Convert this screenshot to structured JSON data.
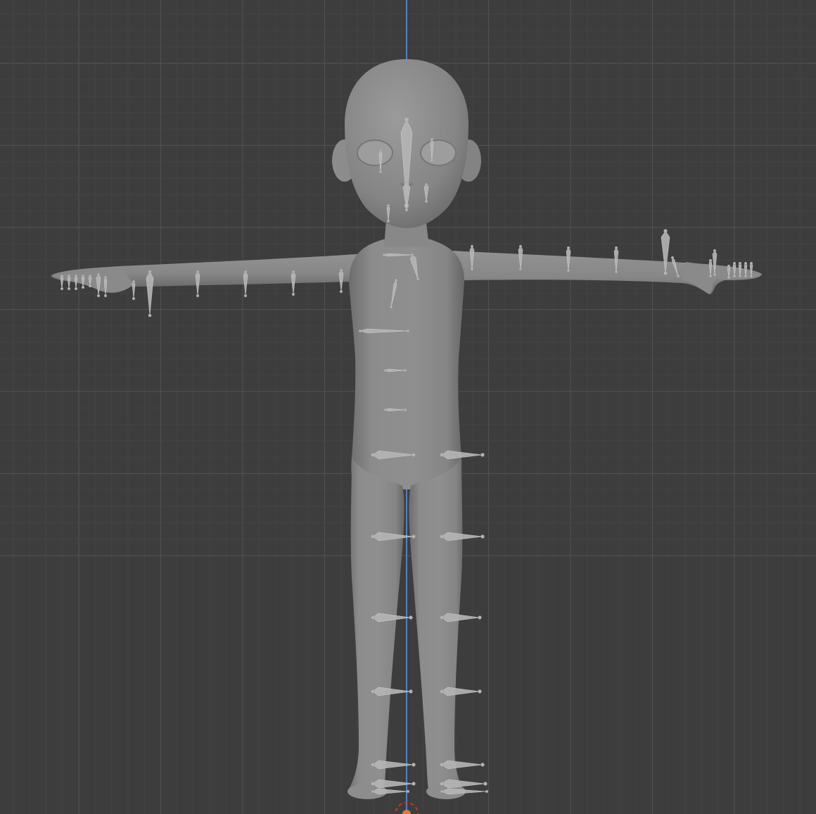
{
  "viewport": {
    "background": "#3d3d3d",
    "grid_minor_color": "#444444",
    "grid_major_color": "#505050",
    "z_axis_color": "#5680c2"
  },
  "model": {
    "mesh_color": "#8a8a8a",
    "mesh_shadow_color": "#707070",
    "bone_color": "#b5b5b5",
    "bone_outline_color": "#d0d0d0"
  },
  "origin_marker": {
    "color": "#e07a3a",
    "ring_color": "#c33a2a"
  }
}
